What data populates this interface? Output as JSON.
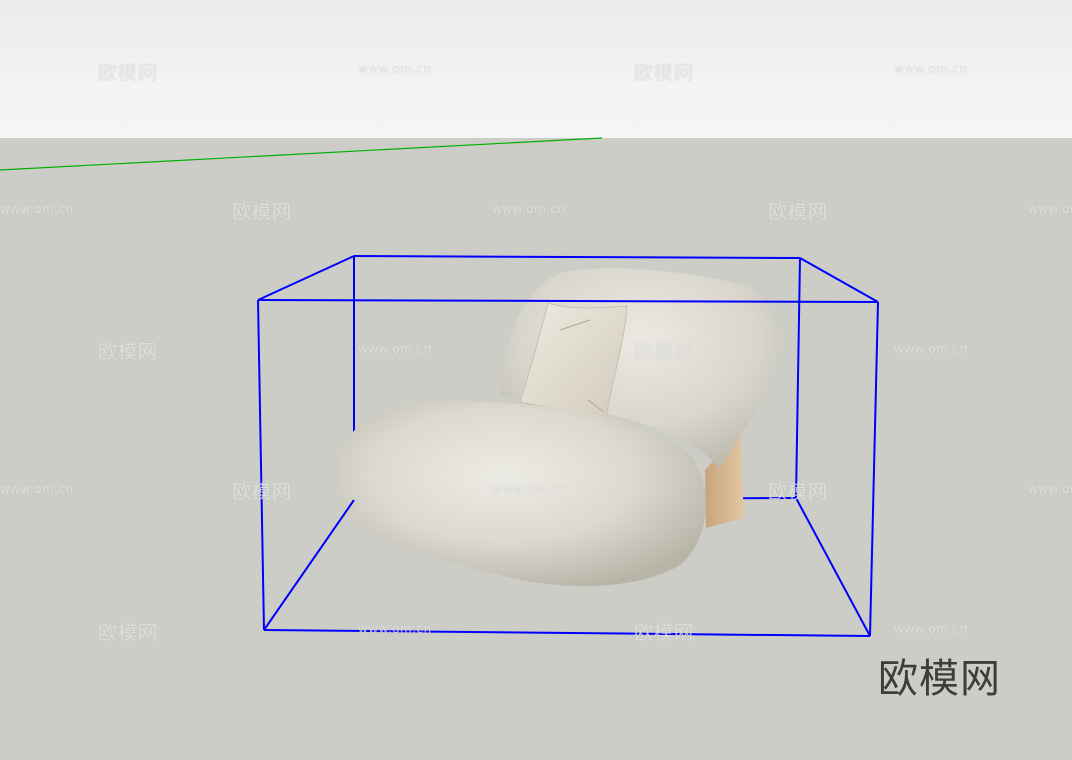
{
  "watermark": {
    "brand_text": "欧模网",
    "url_text": "www.om.cn"
  },
  "logo": {
    "text": "欧模网"
  },
  "scene": {
    "bounding_box_color": "#0000ff",
    "axis_color": "#00b000",
    "sky_color": "#f2f3f4",
    "ground_color": "#cdcdc8",
    "fabric_color": "#dedad0",
    "wood_color": "#d8b892",
    "model": "lounge chair with cushion"
  }
}
